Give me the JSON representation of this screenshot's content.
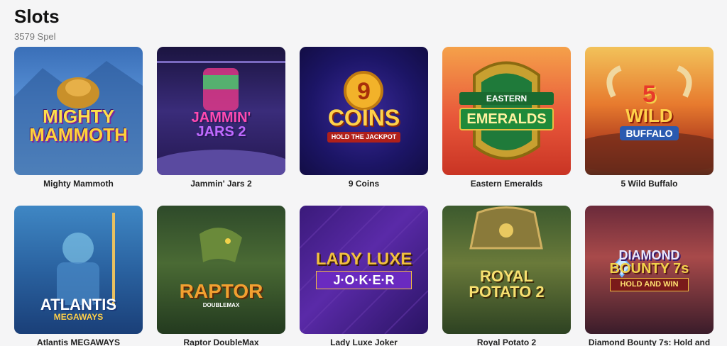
{
  "page": {
    "title": "Slots",
    "count": "3579 Spel"
  },
  "games": [
    {
      "name": "Mighty Mammoth",
      "logo_lines": [
        "MIGHTY",
        "MAMMOTH"
      ]
    },
    {
      "name": "Jammin' Jars 2",
      "logo_lines": [
        "JAMMIN'",
        "JARS 2"
      ]
    },
    {
      "name": "9 Coins",
      "logo_lines": [
        "9",
        "COINS",
        "HOLD THE JACKPOT"
      ]
    },
    {
      "name": "Eastern Emeralds",
      "logo_lines": [
        "EASTERN",
        "EMERALDS"
      ]
    },
    {
      "name": "5 Wild Buffalo",
      "logo_lines": [
        "5",
        "WILD",
        "BUFFALO"
      ]
    },
    {
      "name": "Atlantis MEGAWAYS",
      "logo_lines": [
        "ATLANTIS",
        "MEGAWAYS"
      ]
    },
    {
      "name": "Raptor DoubleMax",
      "logo_lines": [
        "RAPTOR",
        "DOUBLEMAX"
      ]
    },
    {
      "name": "Lady Luxe Joker",
      "logo_lines": [
        "LADY LUXE",
        "J·O·K·E·R"
      ]
    },
    {
      "name": "Royal Potato 2",
      "logo_lines": [
        "ROYAL",
        "POTATO 2"
      ]
    },
    {
      "name": "Diamond Bounty 7s: Hold and",
      "logo_lines": [
        "DIAMOND",
        "BOUNTY 7s",
        "HOLD AND WIN"
      ]
    }
  ]
}
